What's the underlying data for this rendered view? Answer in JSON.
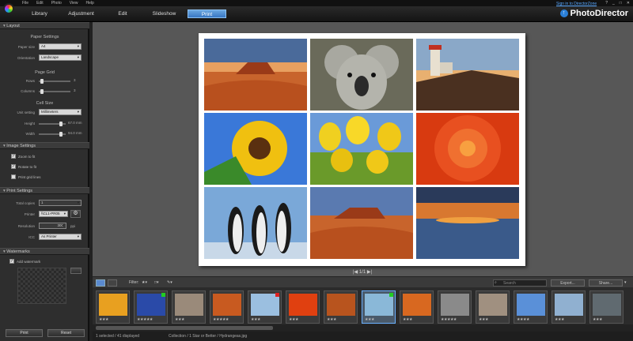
{
  "menu": [
    "File",
    "Edit",
    "Photo",
    "View",
    "Help"
  ],
  "signin": "Sign in to DirectorZone",
  "window_controls": [
    "?",
    "_",
    "□",
    "✕"
  ],
  "brand": "PhotoDirector",
  "modes": [
    "Library",
    "Adjustment",
    "Edit",
    "Slideshow",
    "Print"
  ],
  "sections": {
    "layout": "Layout",
    "image_settings": "Image Settings",
    "print_settings": "Print Settings",
    "watermarks": "Watermarks"
  },
  "paper_settings": {
    "title": "Paper Settings",
    "paper_size_label": "Paper size",
    "paper_size": "A4",
    "orientation_label": "Orientation",
    "orientation": "Landscape"
  },
  "page_grid": {
    "title": "Page Grid",
    "rows_label": "Rows",
    "rows": "3",
    "columns_label": "Columns",
    "columns": "3"
  },
  "cell_size": {
    "title": "Cell Size",
    "unit_label": "Unit setting",
    "unit": "Millimeters",
    "height_label": "Height",
    "height": "67.0 mm",
    "width_label": "Width",
    "width": "94.0 mm"
  },
  "image_settings": {
    "zoom": "Zoom to fit",
    "rotate": "Rotate to fit",
    "grid_lines": "Print grid lines"
  },
  "print_settings": {
    "copies_label": "Total copies",
    "copies": "1",
    "printer_label": "Printer",
    "printer": "\\\\CL1-PR05",
    "resolution_label": "Resolution",
    "resolution": "300",
    "resolution_unit": "ppi",
    "icc_label": "ICC",
    "icc": "As Printer"
  },
  "watermark": {
    "add_label": "Add watermark"
  },
  "buttons": {
    "print": "Print",
    "reset": "Reset"
  },
  "nav": "|◀ 1/1 ▶|",
  "stripbar": {
    "filter": "Filter:",
    "search_placeholder": "Search",
    "export": "Export...",
    "share": "Share..."
  },
  "thumbnails": [
    {
      "stars": "★★★",
      "color": "#e8a020"
    },
    {
      "stars": "★★★★★",
      "color": "#2a4aa8",
      "flag": "#2c2"
    },
    {
      "stars": "★★★",
      "color": "#9a8a7a"
    },
    {
      "stars": "★★★★★",
      "color": "#c85a20"
    },
    {
      "stars": "★★★",
      "color": "#9bbfe0",
      "flag": "#d22"
    },
    {
      "stars": "★★★",
      "color": "#e04010"
    },
    {
      "stars": "★★★",
      "color": "#b8541e"
    },
    {
      "stars": "★★★",
      "color": "#8ab8d8",
      "flag": "#2c2"
    },
    {
      "stars": "★★★",
      "color": "#d86820"
    },
    {
      "stars": "★★★★★",
      "color": "#8a8a8a"
    },
    {
      "stars": "★★★",
      "color": "#a09080"
    },
    {
      "stars": "★★★★",
      "color": "#5a90d8"
    },
    {
      "stars": "★★★",
      "color": "#90b0d0"
    },
    {
      "stars": "★★★",
      "color": "#606a70"
    }
  ],
  "status": {
    "left": "1 selected / 41 displayed",
    "right": "Collection / 1 Star or Better / Hydrangeas.jpg"
  }
}
